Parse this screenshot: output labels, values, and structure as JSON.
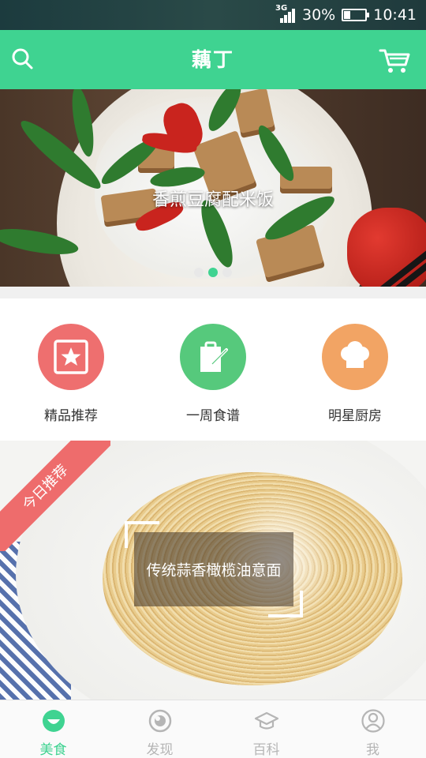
{
  "status_bar": {
    "network": "3G",
    "battery": "30%",
    "battery_level": 0.3,
    "time": "10:41"
  },
  "header": {
    "title": "藕丁",
    "left_icon": "search-icon",
    "right_icon": "cart-icon"
  },
  "banner": {
    "caption": "香煎豆腐配米饭",
    "slides": 3,
    "active_slide": 2
  },
  "categories": [
    {
      "label": "精品推荐",
      "icon": "star-card-icon",
      "color": "#ee6f6f"
    },
    {
      "label": "一周食谱",
      "icon": "clipboard-icon",
      "color": "#56c97c"
    },
    {
      "label": "明星厨房",
      "icon": "chef-hat-icon",
      "color": "#f2a464"
    }
  ],
  "recommendation": {
    "ribbon": "今日推荐",
    "dish": "传统蒜香橄榄油意面",
    "ribbon_color": "#ee6c6c"
  },
  "tabs": [
    {
      "label": "美食",
      "icon": "food-bowl-icon",
      "active": true
    },
    {
      "label": "发现",
      "icon": "discover-icon",
      "active": false
    },
    {
      "label": "百科",
      "icon": "graduation-cap-icon",
      "active": false
    },
    {
      "label": "我",
      "icon": "profile-icon",
      "active": false
    }
  ],
  "colors": {
    "accent": "#3fd391",
    "inactive": "#b5b5b5"
  }
}
